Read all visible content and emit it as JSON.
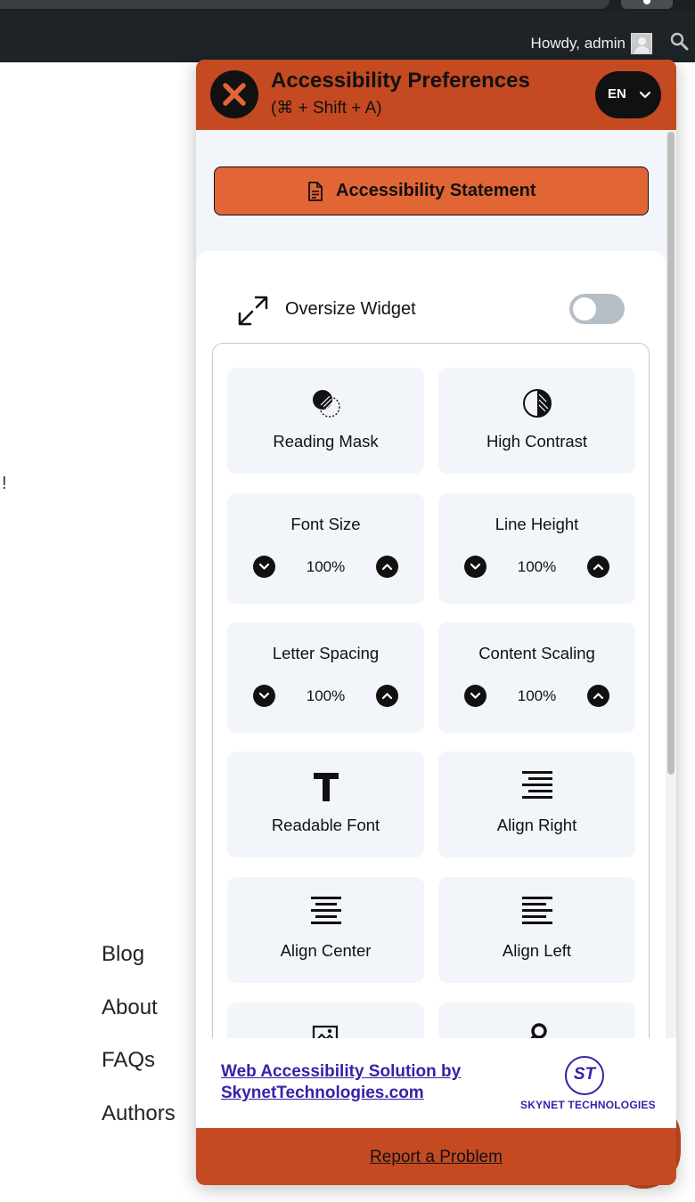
{
  "admin_bar": {
    "greeting": "Howdy, admin"
  },
  "page": {
    "fragment_text": "!",
    "footer_links": [
      "Blog",
      "About",
      "FAQs",
      "Authors"
    ]
  },
  "widget": {
    "title": "Accessibility Preferences",
    "shortcut": "(⌘ + Shift + A)",
    "language": "EN",
    "statement_label": "Accessibility Statement",
    "oversize_label": "Oversize Widget",
    "oversize_enabled": false,
    "tiles": {
      "reading_mask": "Reading Mask",
      "high_contrast": "High Contrast",
      "font_size": {
        "label": "Font Size",
        "value": "100%"
      },
      "line_height": {
        "label": "Line Height",
        "value": "100%"
      },
      "letter_spacing": {
        "label": "Letter Spacing",
        "value": "100%"
      },
      "content_scaling": {
        "label": "Content Scaling",
        "value": "100%"
      },
      "readable_font": "Readable Font",
      "align_right": "Align Right",
      "align_center": "Align Center",
      "align_left": "Align Left"
    },
    "footer": {
      "solution_link": "Web Accessibility Solution by SkynetTechnologies.com",
      "logo_text": "ST",
      "brand_name": "SKYNET TECHNOLOGIES",
      "report_link": "Report a Problem"
    }
  },
  "colors": {
    "brand_orange": "#c54a22",
    "statement_orange": "#e26535",
    "tile_bg": "#f2f5fa",
    "link_purple": "#3a1fa8",
    "admin_bar": "#1d2327"
  }
}
